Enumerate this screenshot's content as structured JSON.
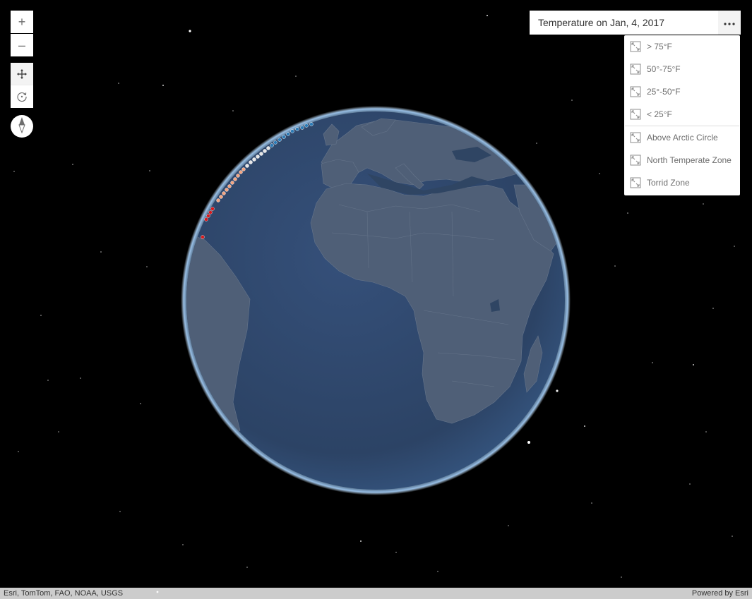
{
  "controls": {
    "zoom_in_label": "+",
    "zoom_out_label": "–"
  },
  "panel": {
    "title": "Temperature on Jan, 4, 2017"
  },
  "menu": {
    "temperature_items": [
      {
        "label": "> 75°F"
      },
      {
        "label": "50°-75°F"
      },
      {
        "label": "25°-50°F"
      },
      {
        "label": "< 25°F"
      }
    ],
    "zone_items": [
      {
        "label": "Above Arctic Circle"
      },
      {
        "label": "North Temperate Zone"
      },
      {
        "label": "Torrid Zone"
      }
    ]
  },
  "attribution": {
    "sources": "Esri, TomTom, FAO, NOAA, USGS",
    "powered_by": "Powered by Esri"
  },
  "colors": {
    "background": "#000000",
    "ocean": "#2f4563",
    "land": "#4e5e75",
    "atmosphere": "#a9d4ff",
    "temp_hot": "#d7191c",
    "temp_warm": "#f4a582",
    "temp_cool": "#e6e6e6",
    "temp_cold": "#2c7bb6"
  },
  "icons": {
    "pan": "pan-icon",
    "rotate": "rotate-icon",
    "compass": "compass-icon",
    "more": "ellipsis-icon",
    "zoom_to": "zoom-to-icon"
  }
}
